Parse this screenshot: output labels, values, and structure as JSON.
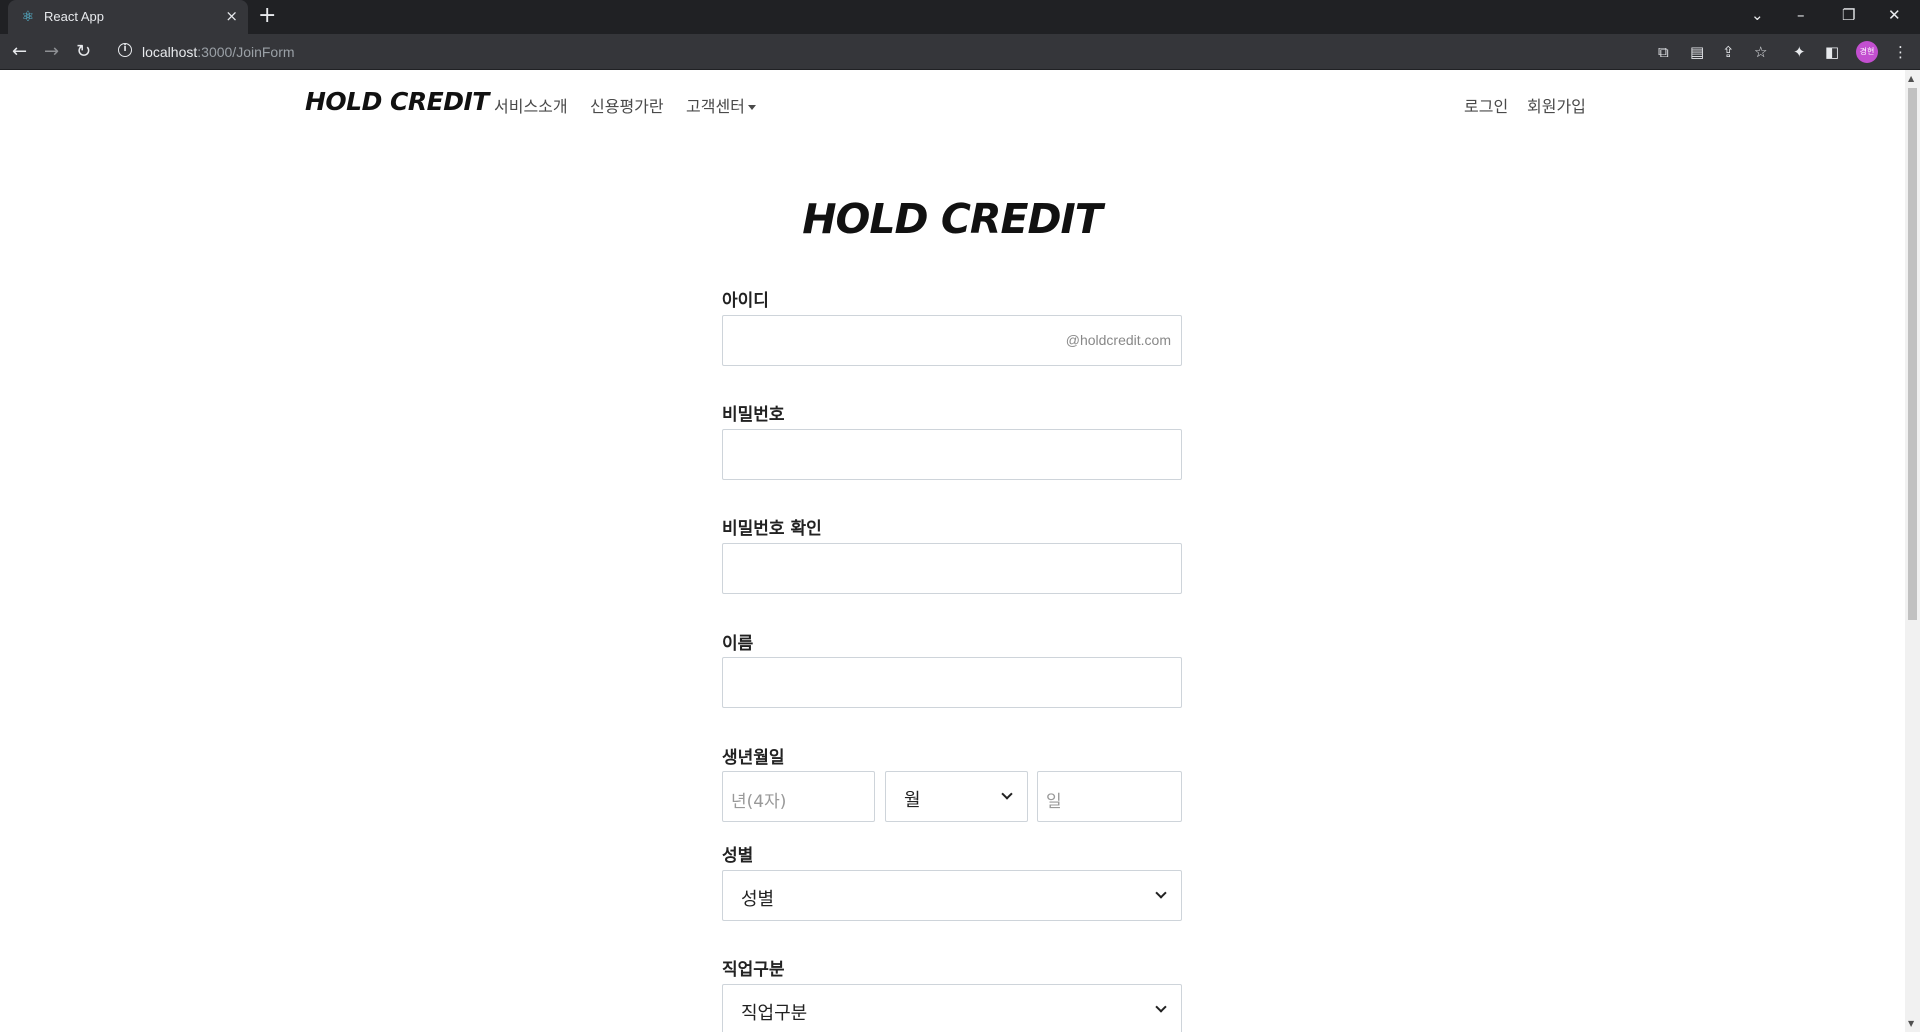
{
  "browser": {
    "tab_title": "React App",
    "tab_close": "×",
    "new_tab": "+",
    "url_host": "localhost",
    "url_path": ":3000/JoinForm",
    "profile_initials": "경현",
    "win_min": "–",
    "win_restore": "❐",
    "win_close": "✕",
    "tab_search": "⌄"
  },
  "navbar": {
    "brand": "HOLD CREDIT",
    "links": [
      "서비스소개",
      "신용평가란",
      "고객센터"
    ],
    "login": "로그인",
    "signup": "회원가입"
  },
  "form": {
    "title": "HOLD CREDIT",
    "id_label": "아이디",
    "id_suffix": "@holdcredit.com",
    "password_label": "비밀번호",
    "password_confirm_label": "비밀번호 확인",
    "name_label": "이름",
    "birth_label": "생년월일",
    "birth_year_placeholder": "년(4자)",
    "birth_month_value": "월",
    "birth_day_placeholder": "일",
    "gender_label": "성별",
    "gender_value": "성별",
    "job_label": "직업구분",
    "job_value": "직업구분"
  },
  "colors": {
    "chrome_dark": "#202124",
    "chrome_toolbar": "#35363a",
    "input_border": "#ced4da",
    "brand_text": "#111111"
  }
}
